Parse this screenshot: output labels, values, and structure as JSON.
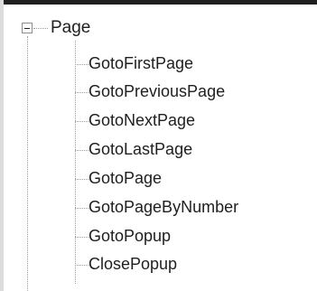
{
  "tree": {
    "root": {
      "label": "Page",
      "expanded": true,
      "toggle_icon": "minus-box-icon"
    },
    "children": [
      {
        "label": "GotoFirstPage"
      },
      {
        "label": "GotoPreviousPage"
      },
      {
        "label": "GotoNextPage"
      },
      {
        "label": "GotoLastPage"
      },
      {
        "label": "GotoPage"
      },
      {
        "label": "GotoPageByNumber"
      },
      {
        "label": "GotoPopup"
      },
      {
        "label": "ClosePopup"
      }
    ]
  }
}
